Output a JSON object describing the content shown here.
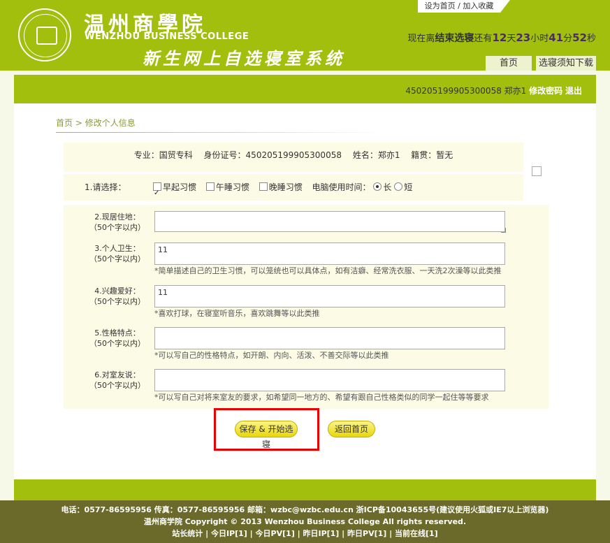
{
  "top_links": "设为首页 / 加入收藏",
  "college": {
    "name_cn": "温州商學院",
    "name_en": "WENZHOU BUSINESS COLLEGE",
    "system_title": "新生网上自选寝室系统"
  },
  "countdown": {
    "prefix": "现在离",
    "event": "结束选寝",
    "mid": "还有",
    "days": "12",
    "days_unit": "天",
    "hours": "23",
    "hours_unit": "小时",
    "minutes": "41",
    "minutes_unit": "分",
    "seconds": "52",
    "seconds_unit": "秒"
  },
  "nav": {
    "home": "首页",
    "guide_download": "选寝须知下载"
  },
  "user": {
    "id": "450205199905300058",
    "name": "郑亦1",
    "change_password": "修改密码",
    "logout": "退出"
  },
  "breadcrumb": {
    "home": "首页",
    "sep": " > ",
    "current": "修改个人信息"
  },
  "student": {
    "major": "专业：国贸专科",
    "id_card": "身份证号：450205199905300058",
    "name": "姓名：郑亦1",
    "origin": "籍贯：暂无"
  },
  "select": {
    "label": "1.请选择：",
    "early_rise": "早起习惯",
    "nap": "午睡习惯",
    "late_sleep": "晚睡习惯",
    "computer_time": "电脑使用时间：",
    "long": "长",
    "short": "短"
  },
  "fields": [
    {
      "label": "2.现居住地：",
      "sub": "（50个字以内）",
      "value": "",
      "hint": ""
    },
    {
      "label": "3.个人卫生：",
      "sub": "（50个字以内）",
      "value": "11",
      "hint": "*简单描述自己的卫生习惯，可以笼统也可以具体点，如有洁癖、经常洗衣服、一天洗2次澡等以此类推"
    },
    {
      "label": "4.兴趣爱好：",
      "sub": "（50个字以内）",
      "value": "11",
      "hint": "*喜欢打球，在寝室听音乐，喜欢跳舞等以此类推"
    },
    {
      "label": "5.性格特点：",
      "sub": "（50个字以内）",
      "value": "",
      "hint": "*可以写自己的性格特点，如开朗、内向、活泼、不善交际等以此类推"
    },
    {
      "label": "6.对室友说：",
      "sub": "（50个字以内）",
      "value": "",
      "hint": "*可以写自己对将来室友的要求，如希望同一地方的、希望有跟自己性格类似的同学一起住等等要求"
    }
  ],
  "buttons": {
    "save": "保存 & 开始选寝",
    "back": "返回首页"
  },
  "footer": {
    "line1": "电话：0577-86595956 传真：0577-86595956 邮箱：wzbc@wzbc.edu.cn 浙ICP备10043655号(建议使用火狐或IE7以上浏览器)",
    "line2": "温州商学院 Copyright © 2013 Wenzhou Business College All rights reserved.",
    "line3": "站长统计 | 今日IP[1] | 今日PV[1] | 昨日IP[1] | 昨日PV[1] | 当前在线[1]"
  },
  "colors": {
    "brand_green": "#a2bf0e",
    "footer_bg": "#6b6a2a",
    "highlight_red": "#e00000"
  }
}
